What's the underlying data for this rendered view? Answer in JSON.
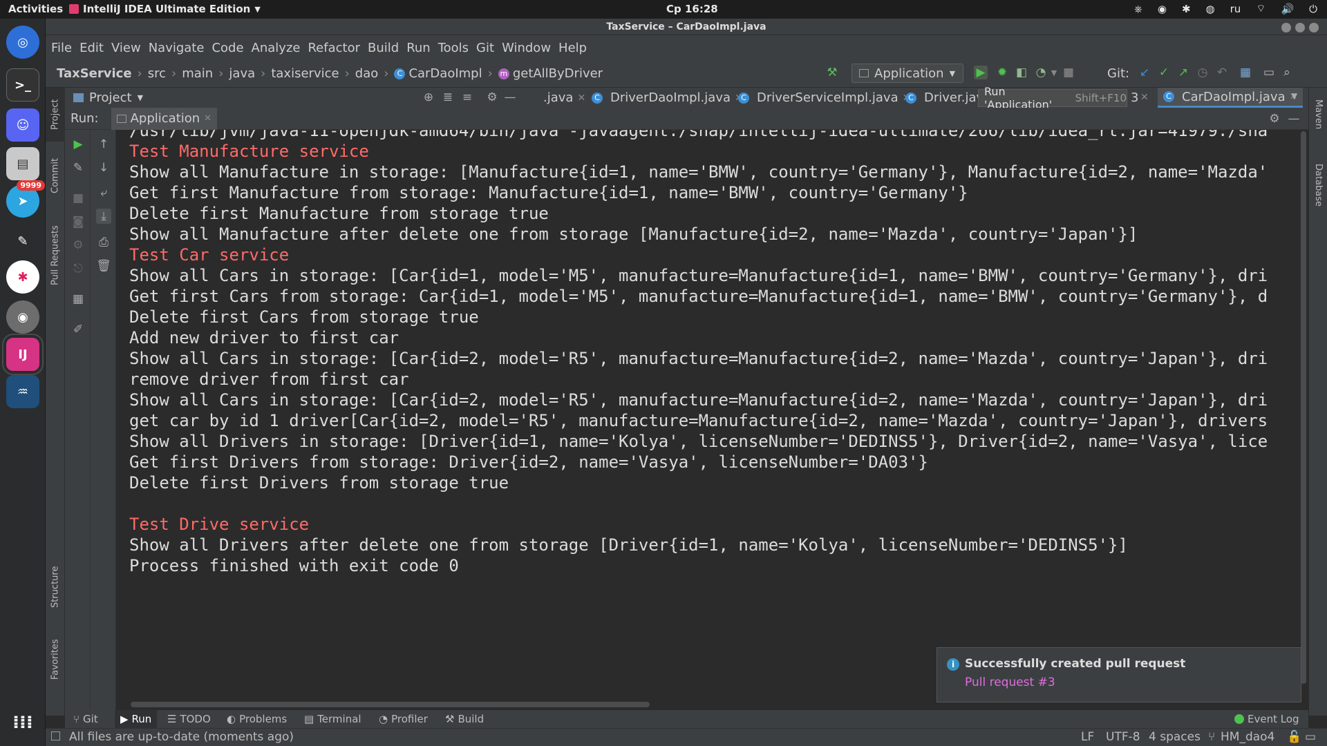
{
  "topbar": {
    "activities": "Activities",
    "app_name": "IntelliJ IDEA Ultimate Edition",
    "clock": "Ср 16:28",
    "lang": "ru"
  },
  "dock": {
    "telegram_badge": "9999"
  },
  "window": {
    "title": "TaxService – CarDaoImpl.java"
  },
  "menu": [
    "File",
    "Edit",
    "View",
    "Navigate",
    "Code",
    "Analyze",
    "Refactor",
    "Build",
    "Run",
    "Tools",
    "Git",
    "Window",
    "Help"
  ],
  "breadcrumb": {
    "project": "TaxService",
    "parts": [
      "src",
      "main",
      "java",
      "taxiservice",
      "dao"
    ],
    "class_name": "CarDaoImpl",
    "method_name": "getAllByDriver"
  },
  "toolbar": {
    "run_config": "Application",
    "git_label": "Git:"
  },
  "project_panel": {
    "title": "Project"
  },
  "editor_tabs": [
    {
      "label": ".java"
    },
    {
      "label": "DriverDaoImpl.java"
    },
    {
      "label": "DriverServiceImpl.java"
    },
    {
      "label": "Driver.java"
    },
    {
      "label": "CarDaoImpl.java"
    }
  ],
  "tooltip": {
    "text": "Run 'Application'",
    "shortcut": "Shift+F10",
    "trailing": "3"
  },
  "run_panel": {
    "label": "Run:",
    "tab": "Application"
  },
  "console": [
    "/usr/lib/jvm/java-11-openjdk-amd64/bin/java -javaagent:/snap/intellij-idea-ultimate/266/lib/idea_rt.jar=41979:/sna",
    "Test Manufacture service",
    "Show all Manufacture in storage: [Manufacture{id=1, name='BMW', country='Germany'}, Manufacture{id=2, name='Mazda'",
    "Get first Manufacture from storage: Manufacture{id=1, name='BMW', country='Germany'}",
    "Delete first Manufacture from storage true",
    "Show all Manufacture after delete one from storage [Manufacture{id=2, name='Mazda', country='Japan'}]",
    "Test Car service",
    "Show all Cars in storage: [Car{id=1, model='M5', manufacture=Manufacture{id=1, name='BMW', country='Germany'}, dri",
    "Get first Cars from storage: Car{id=1, model='M5', manufacture=Manufacture{id=1, name='BMW', country='Germany'}, d",
    "Delete first Cars from storage true",
    "Add new driver to first car",
    "Show all Cars in storage: [Car{id=2, model='R5', manufacture=Manufacture{id=2, name='Mazda', country='Japan'}, dri",
    "remove driver from first car",
    "Show all Cars in storage: [Car{id=2, model='R5', manufacture=Manufacture{id=2, name='Mazda', country='Japan'}, dri",
    "get car by id 1 driver[Car{id=2, model='R5', manufacture=Manufacture{id=2, name='Mazda', country='Japan'}, drivers",
    "Show all Drivers in storage: [Driver{id=1, name='Kolya', licenseNumber='DEDINS5'}, Driver{id=2, name='Vasya', lice",
    "Get first Drivers from storage: Driver{id=2, name='Vasya', licenseNumber='DA03'}",
    "Delete first Drivers from storage true",
    "",
    "Test Drive service",
    "Show all Drivers after delete one from storage [Driver{id=1, name='Kolya', licenseNumber='DEDINS5'}]",
    "Process finished with exit code 0"
  ],
  "notification": {
    "title": "Successfully created pull request",
    "link": "Pull request #3"
  },
  "left_tool_tabs": [
    "Project",
    "Commit",
    "Pull Requests",
    "Structure",
    "Favorites"
  ],
  "right_tool_tabs": [
    "Maven",
    "Database"
  ],
  "bottom_tabs": [
    "Git",
    "Run",
    "TODO",
    "Problems",
    "Terminal",
    "Profiler",
    "Build"
  ],
  "event_log": "Event Log",
  "status": {
    "message": "All files are up-to-date (moments ago)",
    "line_sep": "LF",
    "encoding": "UTF-8",
    "indent": "4 spaces",
    "branch": "HM_dao4"
  },
  "colors": {
    "error_text": "#ff6b68",
    "link": "#e06ce0",
    "run_green": "#4ec24e"
  }
}
